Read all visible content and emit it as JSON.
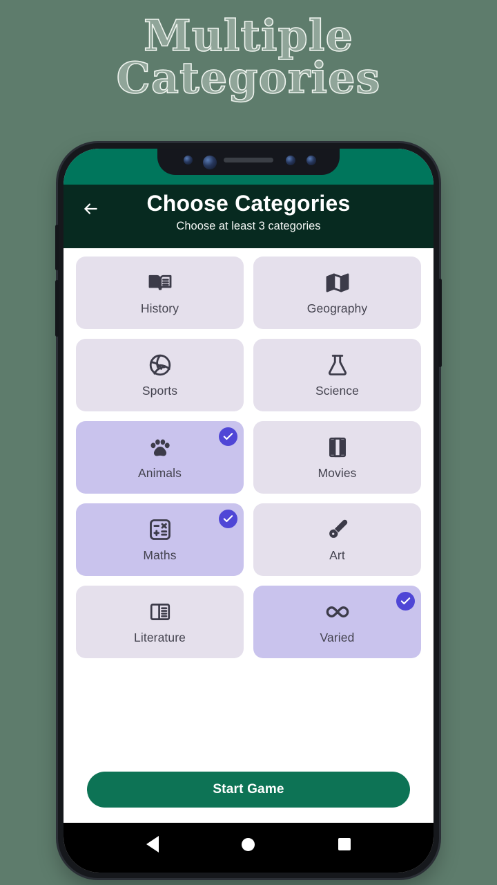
{
  "promo": {
    "line1": "Multiple",
    "line2": "Categories"
  },
  "phone": {
    "status_bar_color": "#00765c",
    "notch": {
      "cameras": [
        "camera-lens",
        "camera-lens-large",
        "sensor-lens",
        "sensor-lens"
      ],
      "speaker": "speaker-grille"
    },
    "hardware_buttons": [
      "volume-up",
      "volume-down",
      "power"
    ]
  },
  "app_bar": {
    "back_icon": "arrow-left-icon",
    "title": "Choose Categories",
    "subtitle": "Choose at least 3 categories",
    "background_color": "#072a20"
  },
  "categories": [
    {
      "label": "History",
      "icon": "open-book-icon",
      "selected": false
    },
    {
      "label": "Geography",
      "icon": "map-icon",
      "selected": false
    },
    {
      "label": "Sports",
      "icon": "volleyball-icon",
      "selected": false
    },
    {
      "label": "Science",
      "icon": "flask-icon",
      "selected": false
    },
    {
      "label": "Animals",
      "icon": "paw-icon",
      "selected": true
    },
    {
      "label": "Movies",
      "icon": "film-strip-icon",
      "selected": false
    },
    {
      "label": "Maths",
      "icon": "calculator-icon",
      "selected": true
    },
    {
      "label": "Art",
      "icon": "paintbrush-icon",
      "selected": false
    },
    {
      "label": "Literature",
      "icon": "article-icon",
      "selected": false
    },
    {
      "label": "Varied",
      "icon": "infinity-icon",
      "selected": true
    }
  ],
  "selection": {
    "selected_count": 3,
    "minimum_required": 3,
    "card_color": "#e5e0ec",
    "selected_card_color": "#c9c3ed",
    "check_badge_color": "#4f46d6"
  },
  "cta": {
    "start_label": "Start Game",
    "color": "#0d7355"
  },
  "nav_bar": {
    "back": "nav-back-icon",
    "home": "nav-home-icon",
    "recents": "nav-recents-icon"
  }
}
